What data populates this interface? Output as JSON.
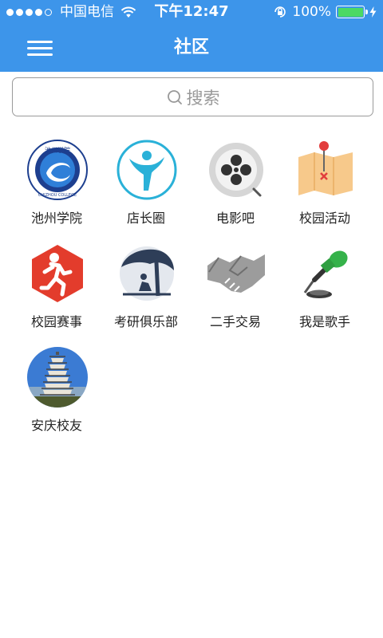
{
  "status": {
    "carrier": "中国电信",
    "time": "下午12:47",
    "battery": "100%",
    "battery_level": 1.0
  },
  "nav": {
    "title": "社区"
  },
  "search": {
    "placeholder": "搜索"
  },
  "communities": [
    {
      "label": "池州学院",
      "icon": "chizhou-college-logo-icon",
      "seal_text": "池州学院",
      "seal_subtext": "CHIZHOU COLLEGE"
    },
    {
      "label": "店长圈",
      "icon": "shop-owner-person-icon"
    },
    {
      "label": "电影吧",
      "icon": "film-reel-icon"
    },
    {
      "label": "校园活动",
      "icon": "map-pin-icon"
    },
    {
      "label": "校园赛事",
      "icon": "runner-icon"
    },
    {
      "label": "考研俱乐部",
      "icon": "reading-under-tree-icon"
    },
    {
      "label": "二手交易",
      "icon": "handshake-icon"
    },
    {
      "label": "我是歌手",
      "icon": "microphone-icon"
    },
    {
      "label": "安庆校友",
      "icon": "pagoda-icon"
    }
  ],
  "colors": {
    "accent": "#3d95ea",
    "battery": "#4cd964"
  }
}
